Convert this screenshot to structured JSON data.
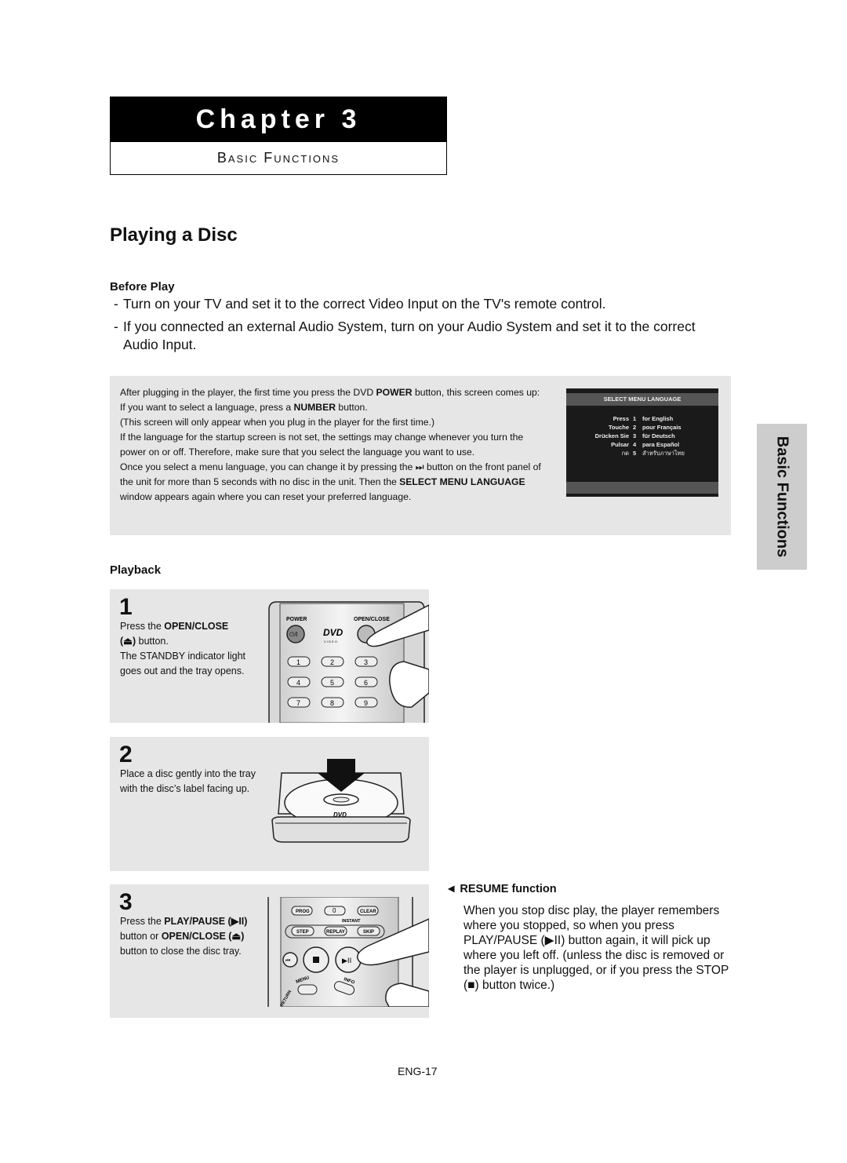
{
  "chapter": {
    "title": "Chapter 3",
    "subtitle": "Basic Functions"
  },
  "page_title": "Playing a Disc",
  "before_play": {
    "heading": "Before Play",
    "bullets": [
      "Turn on your TV and set it to the correct Video Input on the TV's remote control.",
      "If you connected an external Audio System, turn on your Audio System and set it to the correct Audio Input."
    ]
  },
  "info_box": {
    "p1_a": "After plugging in the player, the first time you press the DVD ",
    "p1_b": "POWER",
    "p1_c": " button, this screen comes up: If you want to select a language, press a ",
    "p1_d": "NUMBER",
    "p1_e": " button.",
    "p2": "(This screen will only appear when you plug in the player for the first time.)",
    "p3": "If the language for the startup screen is not set, the settings may change whenever you turn the power on or off. Therefore, make sure that you select the language you want to use.",
    "p4_a": "Once you select a menu language, you can change it by pressing the ",
    "p4_icon": "⏭",
    "p4_b": " button on the front panel of the unit for more than 5 seconds with no disc in the unit. Then the ",
    "p4_c": "SELECT MENU LANGUAGE",
    "p4_d": " window appears again where you can reset your preferred language."
  },
  "tv_screen": {
    "title": "SELECT MENU LANGUAGE",
    "rows": [
      {
        "left": "Press",
        "num": "1",
        "right": "for English"
      },
      {
        "left": "Touche",
        "num": "2",
        "right": "pour Français"
      },
      {
        "left": "Drücken Sie",
        "num": "3",
        "right": "für Deutsch"
      },
      {
        "left": "Pulsar",
        "num": "4",
        "right": "para Español"
      },
      {
        "left": "กด",
        "num": "5",
        "right": "สำหรับภาษาไทย"
      }
    ]
  },
  "side_tab": "Basic Functions",
  "playback": {
    "heading": "Playback",
    "steps": [
      {
        "num": "1",
        "a": "Press the ",
        "b": "OPEN/CLOSE",
        "c": "(⏏)",
        "d": " button.",
        "e": "The STANDBY indicator light goes out and the tray opens."
      },
      {
        "num": "2",
        "text": "Place a disc gently into the tray with the disc’s label facing up."
      },
      {
        "num": "3",
        "a": "Press the ",
        "b": "PLAY/PAUSE (▶II)",
        "c": " button or ",
        "d": "OPEN/CLOSE (⏏)",
        "e": " button to close the disc tray."
      }
    ],
    "remote1": {
      "power": "POWER",
      "power_btn": "⏻/I",
      "dvd": "DVD",
      "video": "V I D E O",
      "open_close": "OPEN/CLOSE",
      "keys": [
        "1",
        "2",
        "3",
        "4",
        "5",
        "6",
        "7",
        "8",
        "9"
      ]
    },
    "remote3": {
      "row1": [
        "PROG",
        "0",
        "CLEAR"
      ],
      "instant": "INSTANT",
      "row2": [
        "STEP",
        "REPLAY",
        "SKIP"
      ],
      "menu": "MENU",
      "info": "INFO",
      "return": "RETURN"
    }
  },
  "resume": {
    "arrow": "◄",
    "heading": "RESUME function",
    "body": "When you stop disc play, the player remembers where you stopped, so when you press PLAY/PAUSE (▶II) button again, it will pick up where you left off. (unless the disc is removed or the player is unplugged, or if you press the STOP (■) button twice.)"
  },
  "page_number": "ENG-17"
}
